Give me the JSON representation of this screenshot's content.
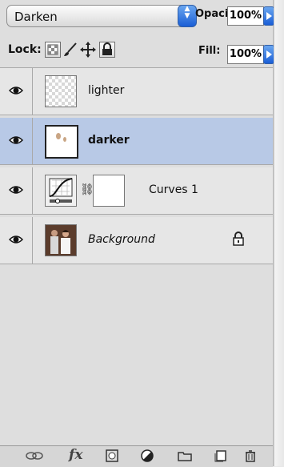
{
  "blend": {
    "mode": "Darken"
  },
  "opacity": {
    "label": "Opacity:",
    "value": "100%"
  },
  "lock": {
    "label": "Lock:"
  },
  "fill": {
    "label": "Fill:",
    "value": "100%"
  },
  "layers": [
    {
      "name": "lighter",
      "selected": false
    },
    {
      "name": "darker",
      "selected": true
    },
    {
      "name": "Curves 1",
      "selected": false
    },
    {
      "name": "Background",
      "selected": false,
      "locked": true
    }
  ],
  "footer": {
    "icons": [
      "link-layers-icon",
      "fx-icon",
      "layer-mask-icon",
      "adjustment-layer-icon",
      "new-group-icon",
      "new-layer-icon",
      "trash-icon"
    ],
    "fx_label": "fx"
  },
  "colors": {
    "selected_row": "#b8c9e6",
    "panel": "#dedede",
    "accent_blue": "#1a5ed6"
  }
}
